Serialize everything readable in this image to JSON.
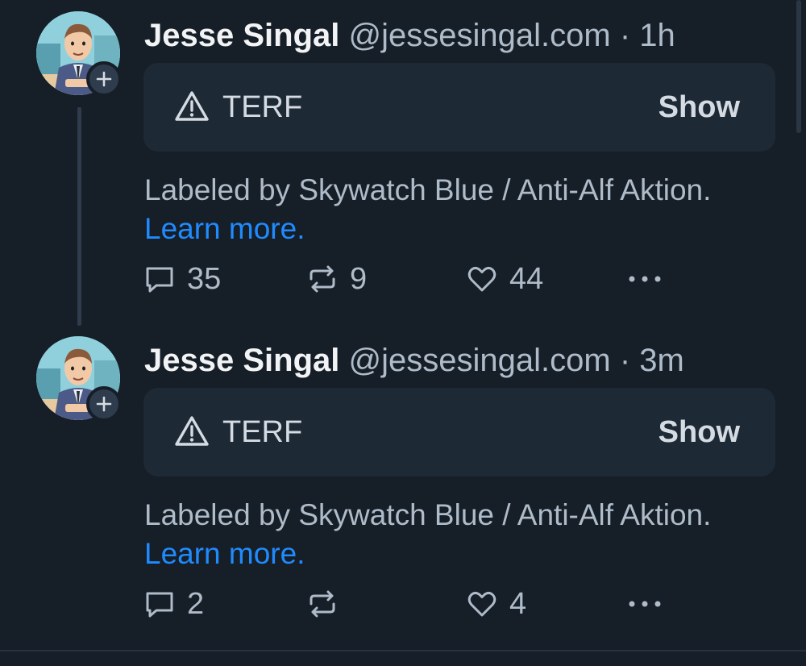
{
  "posts": [
    {
      "author": {
        "name": "Jesse Singal",
        "handle": "@jessesingal.com"
      },
      "separator": "·",
      "time": "1h",
      "label": {
        "name": "TERF",
        "show_label": "Show",
        "icon": "warning-icon"
      },
      "labeled_by": "Labeled by Skywatch Blue / Anti-Alf Aktion.",
      "learn_more": "Learn more.",
      "stats": {
        "replies": "35",
        "reposts": "9",
        "likes": "44"
      },
      "has_thread_line": true
    },
    {
      "author": {
        "name": "Jesse Singal",
        "handle": "@jessesingal.com"
      },
      "separator": "·",
      "time": "3m",
      "label": {
        "name": "TERF",
        "show_label": "Show",
        "icon": "warning-icon"
      },
      "labeled_by": "Labeled by Skywatch Blue / Anti-Alf Aktion.",
      "learn_more": "Learn more.",
      "stats": {
        "replies": "2",
        "reposts": "",
        "likes": "4"
      },
      "has_thread_line": false
    }
  ],
  "colors": {
    "background": "#161e27",
    "card": "#1e2936",
    "muted_text": "#aebbc9",
    "link": "#208bfe",
    "thread_line": "#2e3c4d"
  }
}
